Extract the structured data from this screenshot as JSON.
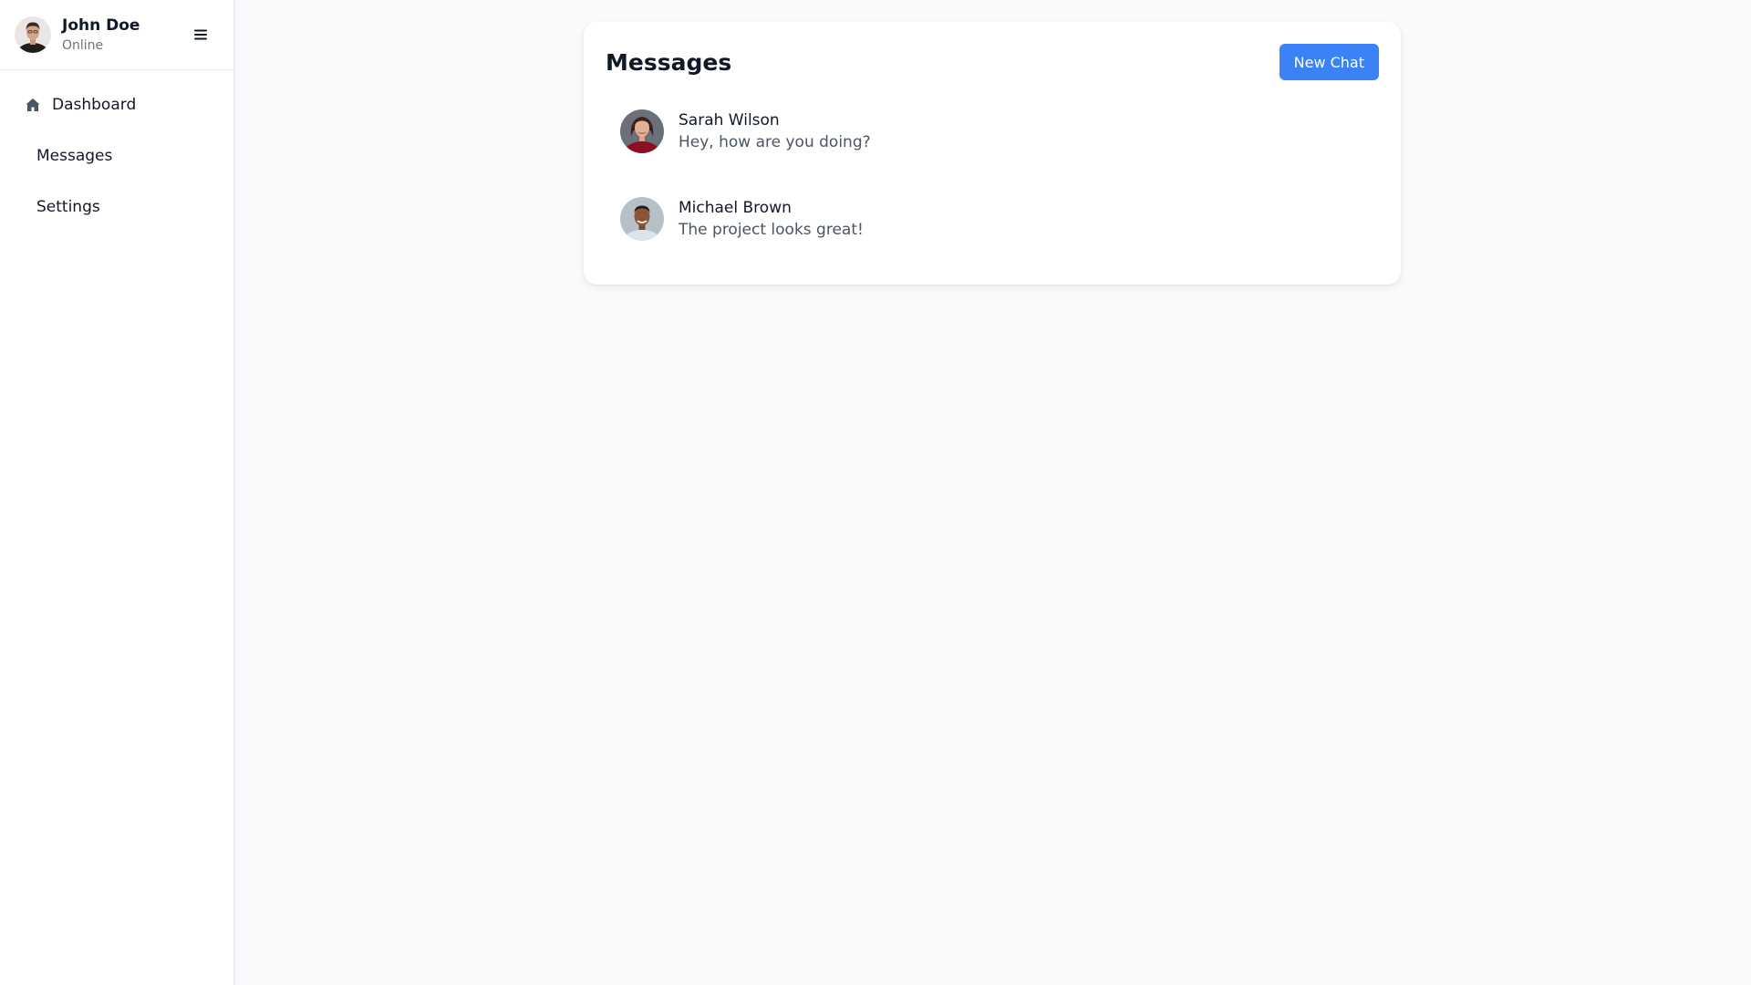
{
  "user": {
    "name": "John Doe",
    "status": "Online",
    "avatar_icon": "user-avatar"
  },
  "sidebar": {
    "menu_icon": "hamburger-icon",
    "items": [
      {
        "label": "Dashboard",
        "icon": "home-icon"
      },
      {
        "label": "Messages"
      },
      {
        "label": "Settings"
      }
    ]
  },
  "messages": {
    "title": "Messages",
    "new_chat_label": "New Chat",
    "accent_color": "#3b82f6",
    "chats": [
      {
        "name": "Sarah Wilson",
        "preview": "Hey, how are you doing?"
      },
      {
        "name": "Michael Brown",
        "preview": "The project looks great!"
      }
    ]
  }
}
